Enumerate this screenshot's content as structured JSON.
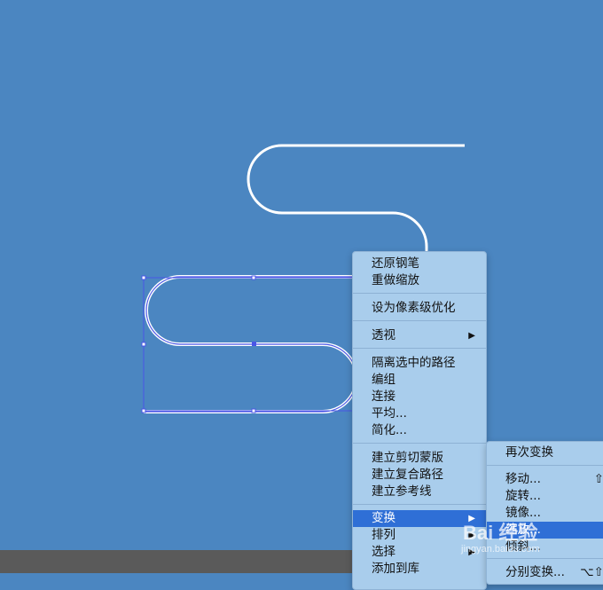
{
  "canvas": {
    "background": "#4b86c1",
    "stroke_color": "#ffffff",
    "selection_color": "#4a56e6"
  },
  "context_menu": {
    "items": [
      {
        "label": "还原钢笔"
      },
      {
        "label": "重做缩放"
      },
      {
        "label": "设为像素级优化"
      },
      {
        "label": "透视",
        "submenu": true
      },
      {
        "label": "隔离选中的路径"
      },
      {
        "label": "编组"
      },
      {
        "label": "连接"
      },
      {
        "label": "平均..."
      },
      {
        "label": "简化..."
      },
      {
        "label": "建立剪切蒙版"
      },
      {
        "label": "建立复合路径"
      },
      {
        "label": "建立参考线"
      },
      {
        "label": "变换",
        "submenu": true,
        "highlighted": true
      },
      {
        "label": "排列",
        "submenu": true
      },
      {
        "label": "选择",
        "submenu": true
      },
      {
        "label": "添加到库"
      }
    ]
  },
  "transform_submenu": {
    "items": [
      {
        "label": "再次变换"
      },
      {
        "label": "移动...",
        "shortcut": "⇧"
      },
      {
        "label": "旋转..."
      },
      {
        "label": "镜像..."
      },
      {
        "label": "缩放...",
        "highlighted": true
      },
      {
        "label": "倾斜..."
      },
      {
        "label": "分别变换...",
        "shortcut": "⌥⇧"
      }
    ]
  },
  "watermark": {
    "brand": "Bai 经验",
    "url": "jingyan.baidu.com"
  },
  "icons": {
    "submenu_arrow": "▶"
  }
}
